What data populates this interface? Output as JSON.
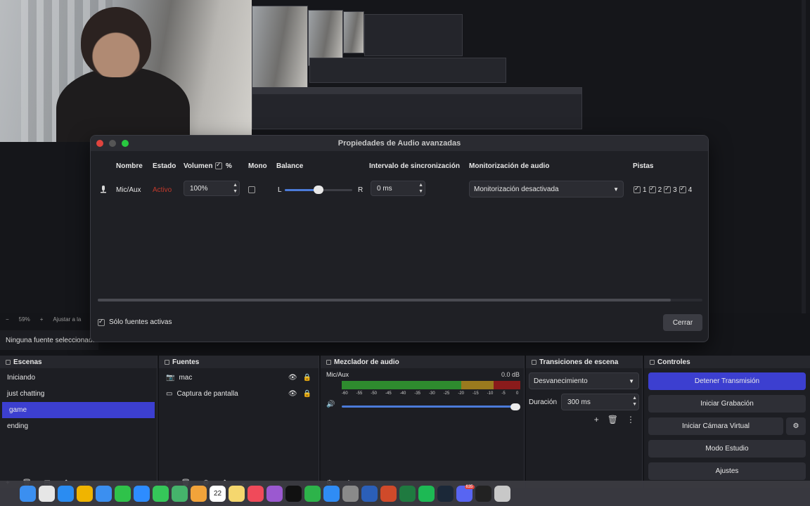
{
  "preview": {
    "zoom": "59%",
    "fit_label": "Ajustar a la",
    "no_source": "Ninguna fuente seleccionada"
  },
  "dialog": {
    "title": "Propiedades de Audio avanzadas",
    "columns": {
      "name": "Nombre",
      "status": "Estado",
      "volume": "Volumen",
      "percent": "%",
      "mono": "Mono",
      "balance": "Balance",
      "sync": "Intervalo de sincronización",
      "monitoring": "Monitorización de audio",
      "tracks": "Pistas"
    },
    "row": {
      "name": "Mic/Aux",
      "status": "Activo",
      "volume": "100%",
      "balance_left": "L",
      "balance_right": "R",
      "balance_level": 0.5,
      "sync": "0 ms",
      "monitoring": "Monitorización desactivada",
      "tracks": [
        "1",
        "2",
        "3",
        "4"
      ]
    },
    "only_active": "Sólo fuentes activas",
    "close": "Cerrar"
  },
  "scenes": {
    "title": "Escenas",
    "items": [
      "Iniciando",
      "just chatting",
      "game",
      "ending"
    ],
    "selected": "game"
  },
  "sources": {
    "title": "Fuentes",
    "items": [
      "mac",
      "Captura de pantalla"
    ]
  },
  "mixer": {
    "title": "Mezclador de audio",
    "channel": "Mic/Aux",
    "db": "0.0 dB",
    "ticks": [
      "-60",
      "-55",
      "-50",
      "-45",
      "-40",
      "-35",
      "-30",
      "-25",
      "-20",
      "-15",
      "-10",
      "-5",
      "0"
    ]
  },
  "transitions": {
    "title": "Transiciones de escena",
    "type": "Desvanecimiento",
    "duration_label": "Duración",
    "duration": "300 ms"
  },
  "controls": {
    "title": "Controles",
    "stop_stream": "Detener Transmisión",
    "start_recording": "Iniciar Grabación",
    "virtual_cam": "Iniciar Cámara Virtual",
    "studio": "Modo Estudio",
    "settings": "Ajustes"
  },
  "dock_apps": [
    "finder",
    "launchpad",
    "safari",
    "chrome",
    "mail",
    "facetime",
    "zoom",
    "messages",
    "maps",
    "photos",
    "calendar",
    "notes",
    "music",
    "podcasts",
    "tv",
    "numbers",
    "appstore",
    "settings",
    "word",
    "powerpoint",
    "excel",
    "spotify",
    "steam",
    "discord",
    "epic games",
    "trash"
  ],
  "calendar_day": "22",
  "discord_badge": "635",
  "colors": {
    "accent": "#3c3fd0",
    "active_status": "#c0392b",
    "meter_green": "#2e8b2e",
    "meter_yellow": "#9a7a1e",
    "meter_red": "#8a1b1b"
  }
}
